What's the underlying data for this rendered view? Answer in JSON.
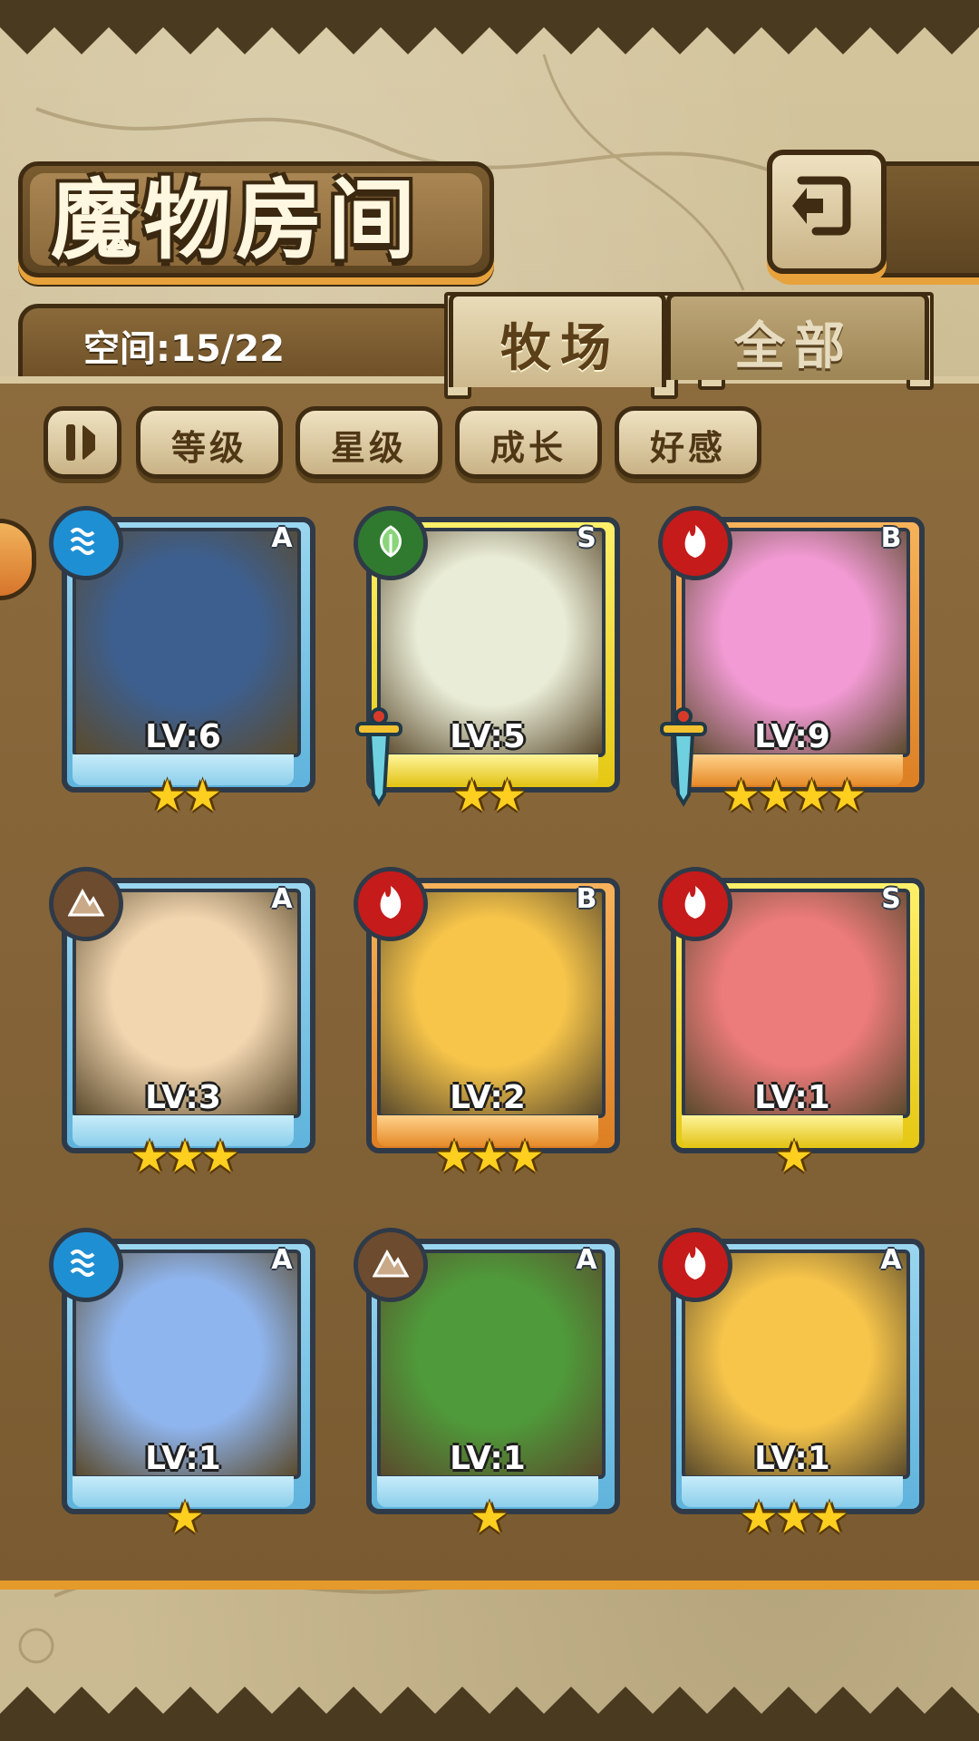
{
  "header": {
    "title": "魔物房间",
    "back_button": "back-arrow-icon"
  },
  "storage": {
    "space_text": "空间:15/22"
  },
  "tabs": [
    {
      "label": "牧场",
      "active": true
    },
    {
      "label": "全部",
      "active": false
    }
  ],
  "sort_buttons": [
    "等级",
    "星级",
    "成长",
    "好感"
  ],
  "monsters": [
    {
      "level": "LV:6",
      "rank": "A",
      "element": "water",
      "stars": 2,
      "frame": "blue",
      "equipped": false,
      "art_color": "#3d5f8f"
    },
    {
      "level": "LV:5",
      "rank": "S",
      "element": "grass",
      "stars": 2,
      "frame": "yellow",
      "equipped": true,
      "art_color": "#e9ecd6"
    },
    {
      "level": "LV:9",
      "rank": "B",
      "element": "fire",
      "stars": 4,
      "frame": "orange",
      "equipped": true,
      "art_color": "#f29ad4"
    },
    {
      "level": "LV:3",
      "rank": "A",
      "element": "earth",
      "stars": 3,
      "frame": "blue",
      "equipped": false,
      "art_color": "#f2d6b0"
    },
    {
      "level": "LV:2",
      "rank": "B",
      "element": "fire",
      "stars": 3,
      "frame": "orange",
      "equipped": false,
      "art_color": "#f7c54a"
    },
    {
      "level": "LV:1",
      "rank": "S",
      "element": "fire",
      "stars": 1,
      "frame": "yellow",
      "equipped": false,
      "art_color": "#ec7b7b"
    },
    {
      "level": "LV:1",
      "rank": "A",
      "element": "water",
      "stars": 1,
      "frame": "blue",
      "equipped": false,
      "art_color": "#8fb5ee"
    },
    {
      "level": "LV:1",
      "rank": "A",
      "element": "earth",
      "stars": 1,
      "frame": "blue",
      "equipped": false,
      "art_color": "#4f9a3a"
    },
    {
      "level": "LV:1",
      "rank": "A",
      "element": "fire",
      "stars": 3,
      "frame": "blue",
      "equipped": false,
      "art_color": "#f7c54a"
    }
  ],
  "colors": {
    "panel": "#7a5b31",
    "accent_orange": "#e59a2c",
    "star": "#ffcf1f"
  }
}
